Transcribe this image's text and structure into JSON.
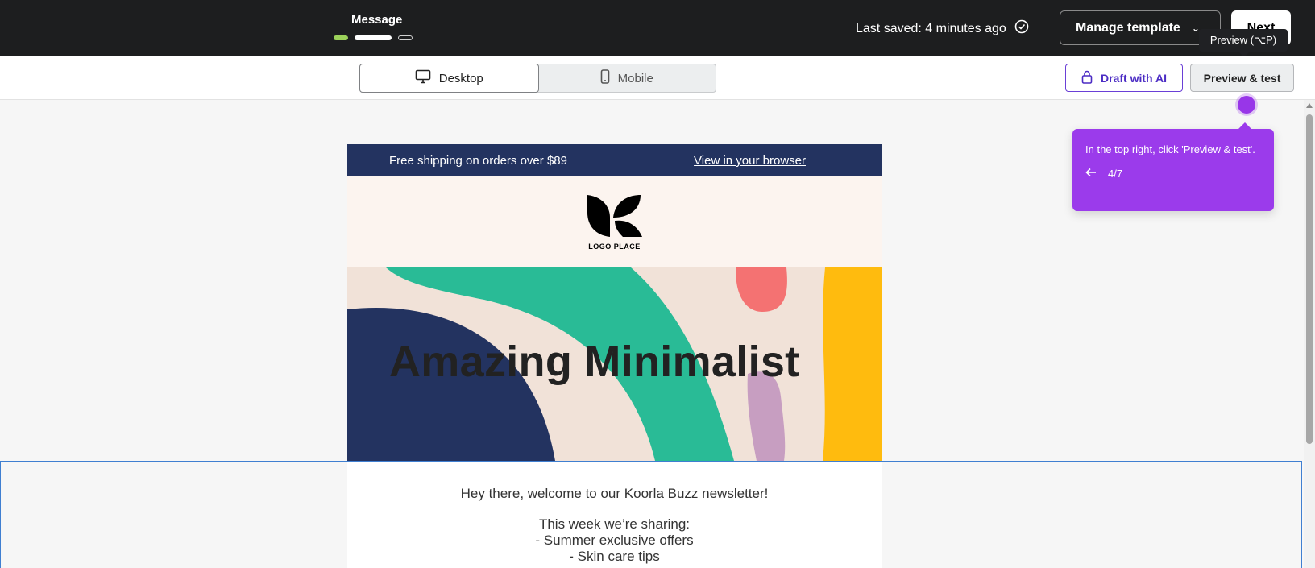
{
  "topbar": {
    "step_title": "Message",
    "saved_text": "Last saved: 4 minutes ago",
    "manage_label": "Manage template",
    "next_label": "Next"
  },
  "tooltip": {
    "text": "Preview (⌥P)"
  },
  "toolbar": {
    "desktop_label": "Desktop",
    "mobile_label": "Mobile",
    "draft_label": "Draft with AI",
    "preview_label": "Preview & test"
  },
  "email": {
    "shipping_text": "Free shipping on orders over $89",
    "browser_link": "View in your browser",
    "logo_text": "LOGO PLACE",
    "hero_title": "Amazing Minimalist",
    "greeting": "Hey there, welcome to our Koorla Buzz newsletter!",
    "sharing_intro": "This week we’re sharing:",
    "bullets": [
      "- Summer exclusive offers",
      "- Skin care tips"
    ]
  },
  "guide": {
    "text": "In the top right, click 'Preview & test'.",
    "step": "4/7"
  },
  "colors": {
    "topbar_bg": "#1d1e1f",
    "accent_purple": "#9b3beb",
    "email_header": "#233360",
    "selection_blue": "#3f7fd1"
  }
}
